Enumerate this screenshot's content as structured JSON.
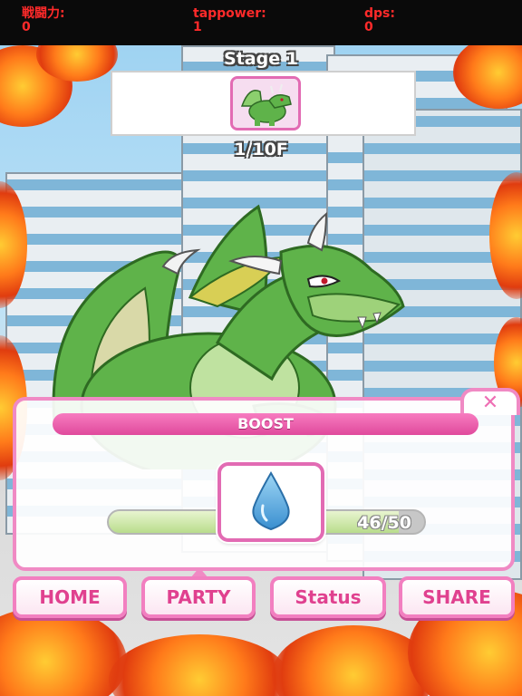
{
  "stats": {
    "power_label": "戦闘力:",
    "power_value": "0",
    "tap_label": "tappower:",
    "tap_value": "1",
    "dps_label": "dps:",
    "dps_value": "0"
  },
  "stage": {
    "title": "Stage 1",
    "floor": "1/10F",
    "enemy_icon": "dragon-icon"
  },
  "boost": {
    "header": "BOOST",
    "close_symbol": "✕",
    "item_icon": "water-drop-icon",
    "value_text": "46/50",
    "fill_fraction": 0.92
  },
  "nav": {
    "home": "HOME",
    "party": "PARTY",
    "status": "Status",
    "share": "SHARE"
  },
  "colors": {
    "stat_text": "#ff2a2a",
    "accent_pink": "#f08ac4",
    "dragon_green": "#5fb34a"
  }
}
